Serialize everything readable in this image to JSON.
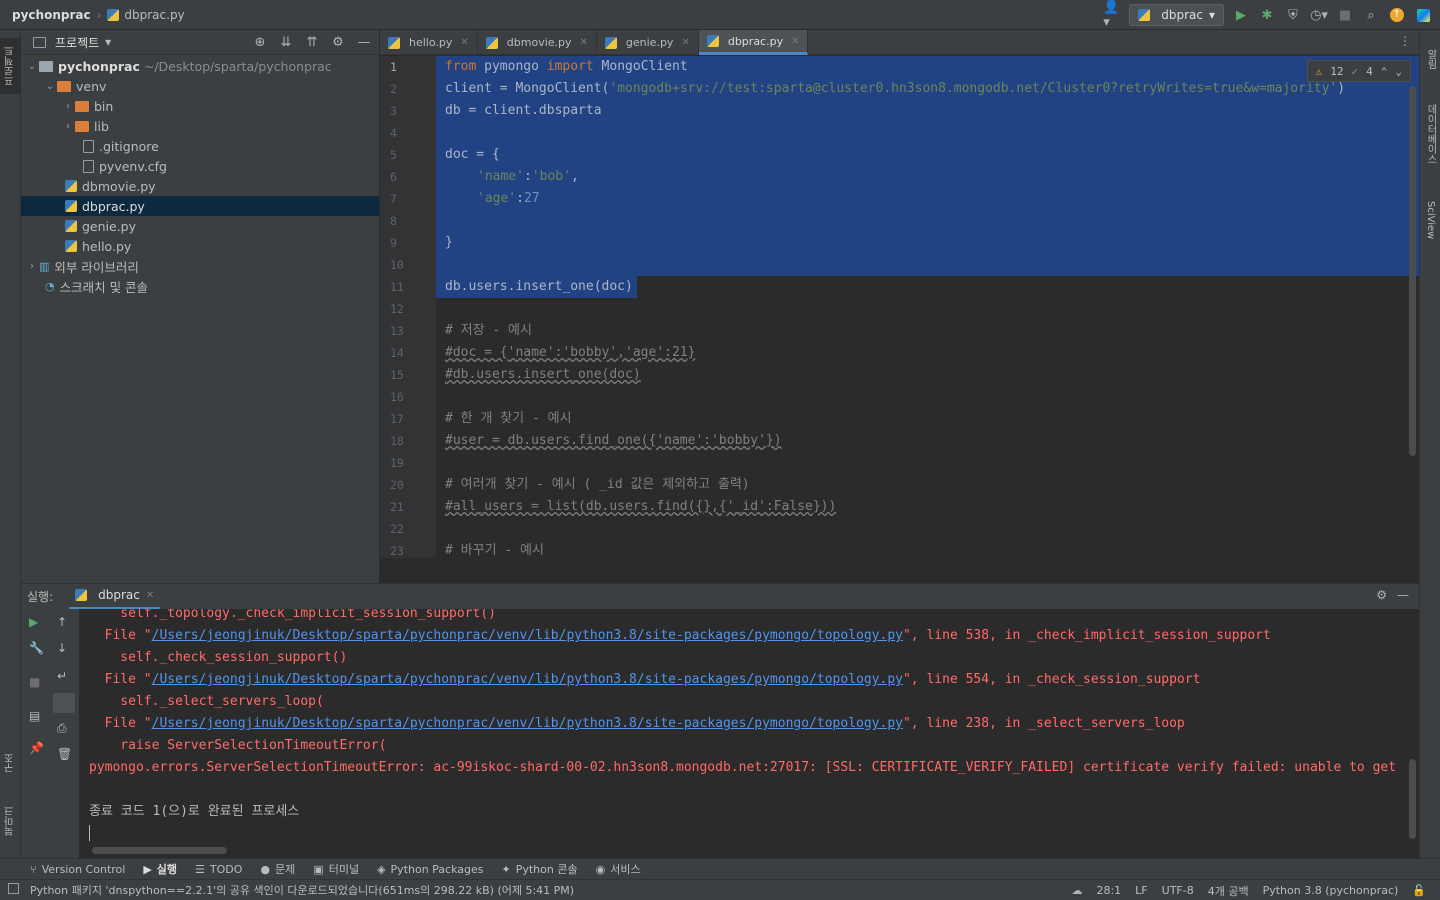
{
  "navbar": {
    "project": "pychonprac",
    "file": "dbprac.py",
    "run_config": "dbprac"
  },
  "left_strip": {
    "project_tab": "프로젝트",
    "structure_tab": "구조",
    "bookmarks_tab": "북마크"
  },
  "right_strip": {
    "notifications_tab": "알림",
    "database_tab": "데이터베이스",
    "sciview_tab": "SciView"
  },
  "project": {
    "title": "프로젝트",
    "tree": [
      {
        "label": "pychonprac",
        "path": "~/Desktop/sparta/pychonprac"
      },
      {
        "label": "venv"
      },
      {
        "label": "bin"
      },
      {
        "label": "lib"
      },
      {
        "label": ".gitignore"
      },
      {
        "label": "pyvenv.cfg"
      },
      {
        "label": "dbmovie.py"
      },
      {
        "label": "dbprac.py"
      },
      {
        "label": "genie.py"
      },
      {
        "label": "hello.py"
      },
      {
        "label": "외부 라이브러리"
      },
      {
        "label": "스크래치 및 콘솔"
      }
    ]
  },
  "tabs": [
    {
      "label": "hello.py"
    },
    {
      "label": "dbmovie.py"
    },
    {
      "label": "genie.py"
    },
    {
      "label": "dbprac.py"
    }
  ],
  "inspection": {
    "warnings": "12",
    "ok": "4"
  },
  "line_numbers": [
    "1",
    "2",
    "3",
    "4",
    "5",
    "6",
    "7",
    "8",
    "9",
    "10",
    "11",
    "12",
    "13",
    "14",
    "15",
    "16",
    "17",
    "18",
    "19",
    "20",
    "21",
    "22",
    "23"
  ],
  "code": {
    "l1_kw1": "from",
    "l1_mod": " pymongo ",
    "l1_kw2": "import",
    "l1_cls": " MongoClient",
    "l2_pre": "client = MongoClient(",
    "l2_str": "'mongodb+srv://test:sparta@cluster0.hn3son8.mongodb.net/Cluster0?retryWrites=true&w=majority'",
    "l2_post": ")",
    "l3": "db = client.dbsparta",
    "l5": "doc = {",
    "l6_key": "'name'",
    "l6_colon": ":",
    "l6_val": "'bob'",
    "l6_comma": ",",
    "l7_key": "'age'",
    "l7_colon": ":",
    "l7_val": "27",
    "l9": "}",
    "l11": "db.users.insert_one(doc)",
    "l13": "# 저장 - 예시",
    "l14": "#doc = {'name':'bobby','age':21}",
    "l15": "#db.users.insert_one(doc)",
    "l17": "# 한 개 찾기 - 예시",
    "l18": "#user = db.users.find_one({'name':'bobby'})",
    "l20": "# 여러개 찾기 - 예시 ( _id 값은 제외하고 출력)",
    "l21": "#all_users = list(db.users.find({},{'_id':False}))",
    "l23": "# 바꾸기 - 예시"
  },
  "run": {
    "label": "실행:",
    "tab": "dbprac"
  },
  "console": {
    "c0": "    self._topology._check_implicit_session_support()",
    "c1_pre": "  File \"",
    "c1_link": "/Users/jeongjinuk/Desktop/sparta/pychonprac/venv/lib/python3.8/site-packages/pymongo/topology.py",
    "c1_post": "\", line 538, in _check_implicit_session_support",
    "c2": "    self._check_session_support()",
    "c3_pre": "  File \"",
    "c3_link": "/Users/jeongjinuk/Desktop/sparta/pychonprac/venv/lib/python3.8/site-packages/pymongo/topology.py",
    "c3_post": "\", line 554, in _check_session_support",
    "c4": "    self._select_servers_loop(",
    "c5_pre": "  File \"",
    "c5_link": "/Users/jeongjinuk/Desktop/sparta/pychonprac/venv/lib/python3.8/site-packages/pymongo/topology.py",
    "c5_post": "\", line 238, in _select_servers_loop",
    "c6": "    raise ServerSelectionTimeoutError(",
    "c7": "pymongo.errors.ServerSelectionTimeoutError: ac-99iskoc-shard-00-02.hn3son8.mongodb.net:27017: [SSL: CERTIFICATE_VERIFY_FAILED] certificate verify failed: unable to get",
    "c9": "종료 코드 1(으)로 완료된 프로세스"
  },
  "bottom_tools": [
    {
      "label": "Version Control"
    },
    {
      "label": "실행"
    },
    {
      "label": "TODO"
    },
    {
      "label": "문제"
    },
    {
      "label": "터미널"
    },
    {
      "label": "Python Packages"
    },
    {
      "label": "Python 콘솔"
    },
    {
      "label": "서비스"
    }
  ],
  "status": {
    "message": "Python 패키지 'dnspython==2.2.1'의 공유 색인이 다운로드되었습니다(651ms의 298.22 kB) (어제 5:41 PM)",
    "position": "28:1",
    "line_sep": "LF",
    "encoding": "UTF-8",
    "indent": "4개 공백",
    "interpreter": "Python 3.8 (pychonprac)"
  },
  "colors": {
    "accent": "#4a88c7",
    "selection": "#214283",
    "error": "#ff6b68",
    "link": "#5394ec"
  }
}
